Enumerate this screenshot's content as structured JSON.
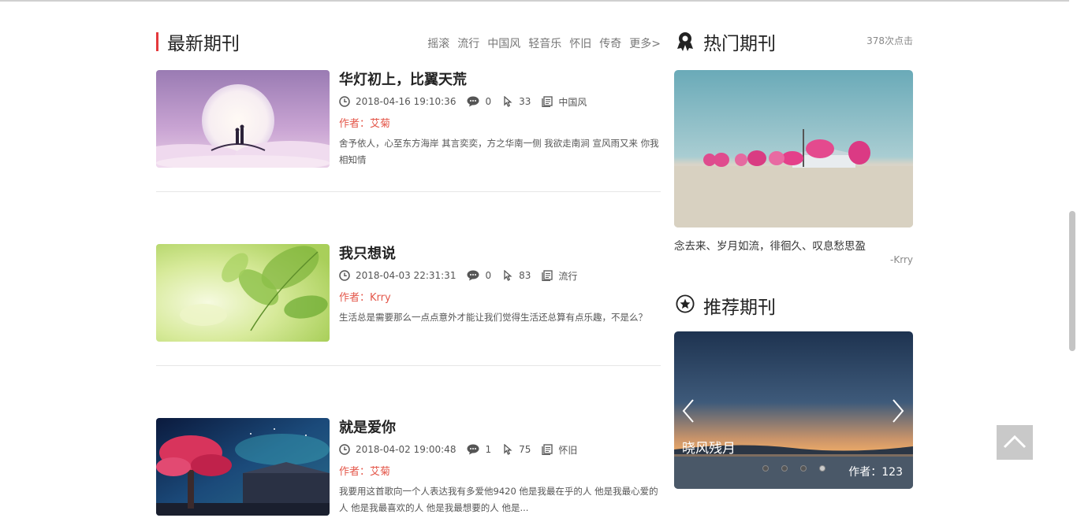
{
  "latest": {
    "title": "最新期刊",
    "categories": [
      "摇滚",
      "流行",
      "中国风",
      "轻音乐",
      "怀旧",
      "传奇",
      "更多>"
    ],
    "articles": [
      {
        "title": "华灯初上，比翼天荒",
        "datetime": "2018-04-16 19:10:36",
        "comments": "0",
        "clicks": "33",
        "category": "中国风",
        "author": "作者：艾菊",
        "desc": "舍予依人，心至东方海岸 其言奕奕，方之华南一侧 我欲走南涧 宣风雨又来 你我相知情"
      },
      {
        "title": "我只想说",
        "datetime": "2018-04-03 22:31:31",
        "comments": "0",
        "clicks": "83",
        "category": "流行",
        "author": "作者：Krry",
        "desc": "生活总是需要那么一点点意外才能让我们觉得生活还总算有点乐趣，不是么？"
      },
      {
        "title": "就是爱你",
        "datetime": "2018-04-02 19:00:48",
        "comments": "1",
        "clicks": "75",
        "category": "怀旧",
        "author": "作者：艾菊",
        "desc": "我要用这首歌向一个人表达我有多爱他9420 他是我最在乎的人 他是我最心爱的人 他是我最喜欢的人 他是我最想要的人 他是..."
      }
    ]
  },
  "hot": {
    "title": "热门期刊",
    "clicks": "378次点击",
    "quote": "念去来、岁月如流，徘徊久、叹息愁思盈",
    "author": "-Krry"
  },
  "recommend": {
    "title": "推荐期刊",
    "caption": "晓风残月",
    "author": "作者：123"
  },
  "colors": {
    "accent": "#e4393c",
    "author": "#e4574a",
    "back_to_top": "#c9c9c9"
  },
  "icons": [
    "clock-icon",
    "comment-icon",
    "cursor-icon",
    "category-icon",
    "award-icon",
    "star-icon",
    "chevron-left-icon",
    "chevron-right-icon",
    "chevron-up-icon"
  ]
}
